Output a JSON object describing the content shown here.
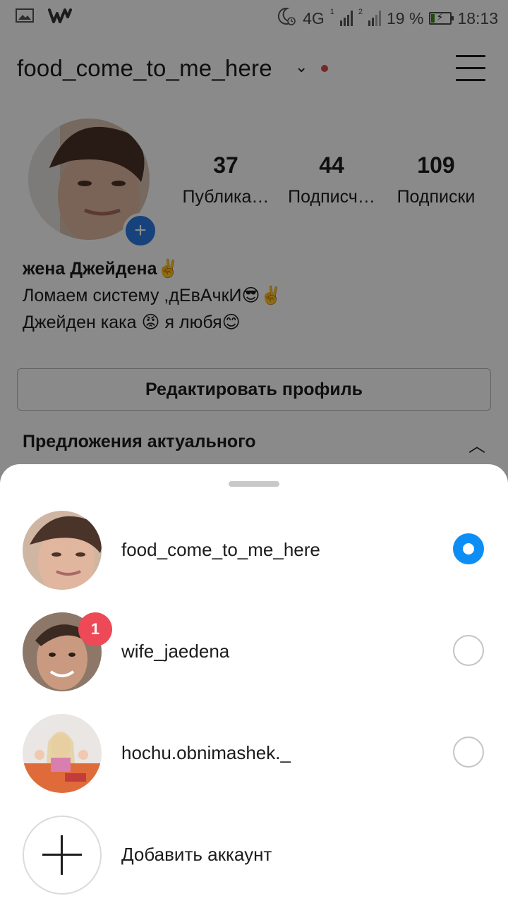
{
  "status_bar": {
    "network": "4G",
    "sim1_label": "1",
    "sim2_label": "2",
    "battery": "19 %",
    "battery_level": 0.19,
    "time": "18:13",
    "icons": [
      "gallery-icon",
      "wattpad-icon",
      "do-not-disturb-moon-icon",
      "signal-icon",
      "battery-charging-icon"
    ]
  },
  "header": {
    "username": "food_come_to_me_here",
    "chevron": "⌄",
    "menu_icon": "hamburger-menu-icon"
  },
  "profile": {
    "add_story_symbol": "+",
    "stats": [
      {
        "value": "37",
        "label": "Публика…"
      },
      {
        "value": "44",
        "label": "Подписч…"
      },
      {
        "value": "109",
        "label": "Подписки"
      }
    ],
    "bio": {
      "name_line": "жена Джейдена✌️",
      "line2": "Ломаем систему ,дЕвАчкИ😎✌️",
      "line3": "Джейден кака 😡 я любя😊"
    },
    "edit_button": "Редактировать профиль",
    "highlights_title": "Предложения актуального"
  },
  "account_switcher": {
    "accounts": [
      {
        "username": "food_come_to_me_here",
        "selected": true,
        "notifications": ""
      },
      {
        "username": "wife_jaedena",
        "selected": false,
        "notifications": "1"
      },
      {
        "username": "hochu.obnimashek._",
        "selected": false,
        "notifications": ""
      }
    ],
    "add_account_label": "Добавить аккаунт"
  },
  "colors": {
    "accent_blue": "#0d8ef5",
    "badge_red": "#ee4956",
    "add_story_blue": "#2c7be5",
    "overlay": "rgba(0,0,0,0.46)"
  }
}
